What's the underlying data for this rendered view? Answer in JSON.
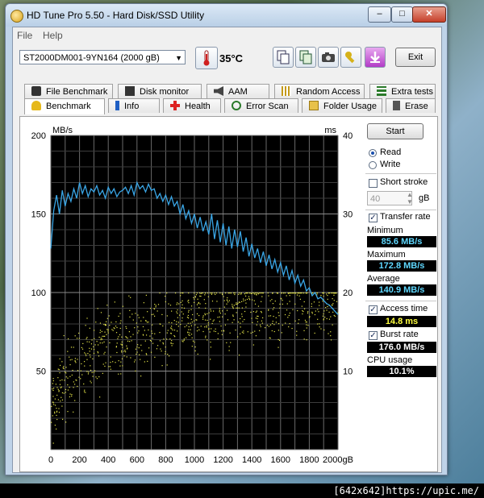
{
  "window": {
    "title": "HD Tune Pro 5.50 - Hard Disk/SSD Utility"
  },
  "menu": [
    "File",
    "Help"
  ],
  "toolbar": {
    "drive": "ST2000DM001-9YN164 (2000 gB)",
    "temperature": "35",
    "temperature_unit": "°C",
    "icons": [
      "copy-icon",
      "copy-info-icon",
      "camera-icon",
      "wrench-icon",
      "save-icon"
    ],
    "exit_label": "Exit"
  },
  "tabs_row1": [
    {
      "label": "File Benchmark",
      "icon": "file-benchmark-icon"
    },
    {
      "label": "Disk monitor",
      "icon": "disk-monitor-icon"
    },
    {
      "label": "AAM",
      "icon": "speaker-icon"
    },
    {
      "label": "Random Access",
      "icon": "random-access-icon"
    },
    {
      "label": "Extra tests",
      "icon": "extra-tests-icon"
    }
  ],
  "tabs_row2": [
    {
      "label": "Benchmark",
      "icon": "benchmark-icon",
      "active": true
    },
    {
      "label": "Info",
      "icon": "info-icon"
    },
    {
      "label": "Health",
      "icon": "health-icon"
    },
    {
      "label": "Error Scan",
      "icon": "error-scan-icon"
    },
    {
      "label": "Folder Usage",
      "icon": "folder-icon"
    },
    {
      "label": "Erase",
      "icon": "erase-icon"
    }
  ],
  "controls": {
    "start_label": "Start",
    "read_label": "Read",
    "write_label": "Write",
    "mode": "read",
    "short_stroke_label": "Short stroke",
    "short_stroke_checked": false,
    "short_stroke_value": "40",
    "short_stroke_unit": "gB",
    "transfer_rate_label": "Transfer rate",
    "transfer_rate_checked": true,
    "minimum_label": "Minimum",
    "minimum_value": "85.6 MB/s",
    "maximum_label": "Maximum",
    "maximum_value": "172.8 MB/s",
    "average_label": "Average",
    "average_value": "140.9 MB/s",
    "access_time_label": "Access time",
    "access_time_checked": true,
    "access_time_value": "14.8 ms",
    "burst_rate_label": "Burst rate",
    "burst_rate_checked": true,
    "burst_rate_value": "176.0 MB/s",
    "cpu_usage_label": "CPU usage",
    "cpu_usage_value": "10.1%"
  },
  "footer": {
    "text": "[642x642]https://upic.me/"
  },
  "colors": {
    "chart_bg": "#000000",
    "grid": "#6a6a6a",
    "transfer_line": "#3aa6e6",
    "access_dots": "#e6e64a"
  },
  "chart_data": {
    "type": "line",
    "xlabel": "gB",
    "ylabel_left": "MB/s",
    "ylabel_right": "ms",
    "xlim": [
      0,
      2000
    ],
    "ylim_left": [
      0,
      200
    ],
    "ylim_right": [
      0,
      40
    ],
    "x_ticks": [
      "0",
      "200",
      "400",
      "600",
      "800",
      "1000",
      "1200",
      "1400",
      "1600",
      "1800",
      "2000gB"
    ],
    "y_ticks_left": [
      "200",
      "150",
      "100",
      "50"
    ],
    "y_ticks_right": [
      "40",
      "30",
      "20",
      "10"
    ],
    "grid": true,
    "series": [
      {
        "kind": "line",
        "axis": "left",
        "x": [
          0,
          20,
          40,
          60,
          80,
          100,
          120,
          140,
          160,
          180,
          200,
          220,
          240,
          260,
          280,
          300,
          320,
          340,
          360,
          380,
          400,
          420,
          440,
          460,
          480,
          500,
          520,
          540,
          560,
          580,
          600,
          620,
          640,
          660,
          680,
          700,
          720,
          740,
          760,
          780,
          800,
          820,
          840,
          860,
          880,
          900,
          920,
          940,
          960,
          980,
          1000,
          1020,
          1040,
          1060,
          1080,
          1100,
          1120,
          1140,
          1160,
          1180,
          1200,
          1220,
          1240,
          1260,
          1280,
          1300,
          1320,
          1340,
          1360,
          1380,
          1400,
          1420,
          1440,
          1460,
          1480,
          1500,
          1520,
          1540,
          1560,
          1580,
          1600,
          1620,
          1640,
          1660,
          1680,
          1700,
          1720,
          1740,
          1760,
          1780,
          1800,
          1820,
          1840,
          1860,
          1880,
          1900,
          1920,
          1940,
          1960,
          1980,
          2000
        ],
        "values": [
          128,
          152,
          162,
          150,
          165,
          155,
          163,
          158,
          166,
          160,
          170,
          163,
          168,
          161,
          166,
          164,
          168,
          162,
          165,
          160,
          167,
          163,
          166,
          161,
          164,
          165,
          167,
          163,
          168,
          162,
          170,
          166,
          168,
          164,
          169,
          165,
          166,
          160,
          163,
          158,
          162,
          156,
          161,
          155,
          158,
          150,
          156,
          147,
          152,
          144,
          150,
          141,
          148,
          139,
          145,
          137,
          150,
          134,
          146,
          132,
          144,
          130,
          142,
          128,
          140,
          129,
          139,
          126,
          135,
          123,
          131,
          122,
          128,
          119,
          126,
          117,
          124,
          115,
          121,
          113,
          119,
          111,
          117,
          108,
          114,
          106,
          111,
          104,
          108,
          101,
          103,
          98,
          100,
          96,
          97,
          95,
          93,
          92,
          90,
          88,
          86
        ]
      },
      {
        "kind": "scatter",
        "axis": "right",
        "description_points": "access time samples",
        "trend_x": [
          0,
          100,
          200,
          300,
          400,
          500,
          600,
          700,
          800,
          900,
          1000,
          1100,
          1200,
          1300,
          1400,
          1500,
          1600,
          1700,
          1800,
          1900,
          2000
        ],
        "trend_y": [
          6,
          9,
          11,
          12.5,
          13.5,
          14.5,
          15,
          15.5,
          16,
          16.5,
          17,
          17.3,
          17.6,
          17.9,
          18,
          18.3,
          18.5,
          18.7,
          19,
          19.2,
          19.5
        ],
        "spread": [
          0,
          20
        ]
      }
    ]
  }
}
